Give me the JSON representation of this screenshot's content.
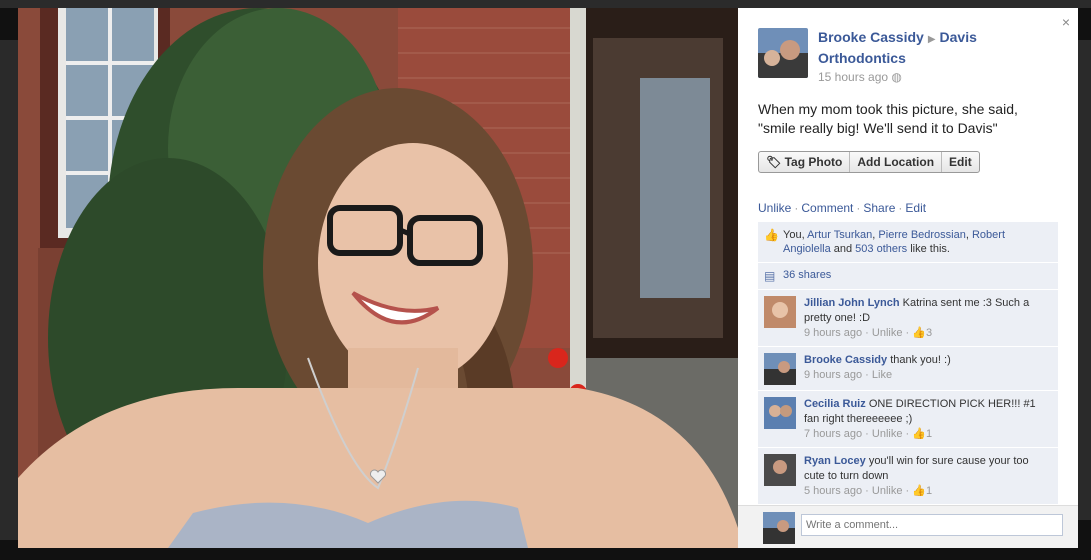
{
  "post": {
    "author": "Brooke Cassidy",
    "target": "Davis Orthodontics",
    "time": "15 hours ago",
    "caption": "When my mom took this picture, she said, \"smile really big! We'll send it to Davis\""
  },
  "buttons": {
    "tag": "Tag Photo",
    "location": "Add Location",
    "edit": "Edit"
  },
  "actions": {
    "unlike": "Unlike",
    "comment": "Comment",
    "share": "Share",
    "edit": "Edit"
  },
  "likes": {
    "prefix": "You, ",
    "name1": "Artur Tsurkan",
    "name2": "Pierre Bedrossian",
    "name3": "Robert Angiolella",
    "and": " and ",
    "others": "503 others",
    "suffix": " like this."
  },
  "shares": "36 shares",
  "comments": [
    {
      "author": "Jillian John Lynch",
      "text": "Katrina sent me :3 Such a pretty one! :D",
      "time": "9 hours ago",
      "action": "Unlike",
      "likes": "3"
    },
    {
      "author": "Brooke Cassidy",
      "text": "thank you! :)",
      "time": "9 hours ago",
      "action": "Like",
      "likes": ""
    },
    {
      "author": "Cecilia Ruiz",
      "text": "ONE DIRECTION PICK HER!!! #1 fan right thereeeeee ;)",
      "time": "7 hours ago",
      "action": "Unlike",
      "likes": "1"
    },
    {
      "author": "Ryan Locey",
      "text": "you'll win for sure cause your too cute to turn down",
      "time": "5 hours ago",
      "action": "Unlike",
      "likes": "1"
    }
  ],
  "compose_placeholder": "Write a comment...",
  "close": "×"
}
